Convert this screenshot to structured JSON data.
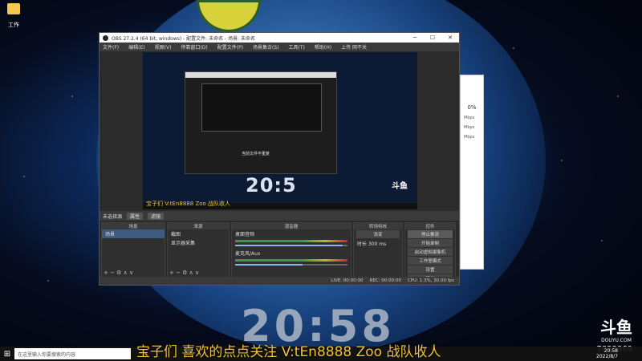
{
  "desktop": {
    "icon_label": "工作"
  },
  "obs": {
    "title": "OBS 27.2.4 (64 bit, windows) - 配置文件: 未命名 - 场景: 未命名",
    "menu": [
      "文件(F)",
      "编辑(E)",
      "视图(V)",
      "停靠窗口(D)",
      "配置文件(P)",
      "场景集合(S)",
      "工具(T)",
      "帮助(H)",
      "上传 网不关"
    ],
    "preview_toast": "当前文件不重复",
    "preview_clock": "20:5",
    "preview_logo": "斗鱼",
    "preview_ticker": "宝子们 V:tEn8888 Zoo 战队收人",
    "scene_label": "未选择源",
    "scene_pills": [
      "属性",
      "滤镜"
    ],
    "docks": {
      "scenes": {
        "header": "场景",
        "items": [
          "场景"
        ]
      },
      "sources": {
        "header": "来源",
        "items": [
          "截图",
          "显示器采集"
        ]
      },
      "mixer": {
        "header": "混音器",
        "tracks": [
          {
            "name": "桌面音频",
            "level": 0.96
          },
          {
            "name": "麦克风/Aux",
            "level": 0.6
          }
        ]
      },
      "transitions": {
        "header": "转场特效",
        "type": "渐变",
        "duration_label": "时长",
        "duration": "300 ms"
      },
      "controls": {
        "header": "控件",
        "buttons": [
          "停止推流",
          "开始录制",
          "启动虚拟摄像机",
          "工作室模式",
          "设置",
          "退出"
        ]
      }
    },
    "status": {
      "live": "LIVE: 00:00:00",
      "rec": "REC: 00:00:00",
      "cpu": "CPU: 1.3%, 30.00 fps"
    }
  },
  "side_window": {
    "percent": "0%",
    "rate_label": "Mbps"
  },
  "overlay": {
    "big_clock": "20:58",
    "logo_text": "斗鱼",
    "logo_sub": "DOUYU.COM",
    "room_id": "7833869",
    "ticker": "宝子们 喜欢的点点关注 V:tEn8888 Zoo 战队收人"
  },
  "taskbar": {
    "search_placeholder": "在这里输入你要搜索的内容",
    "time": "20:58",
    "date": "2022/8/7"
  }
}
